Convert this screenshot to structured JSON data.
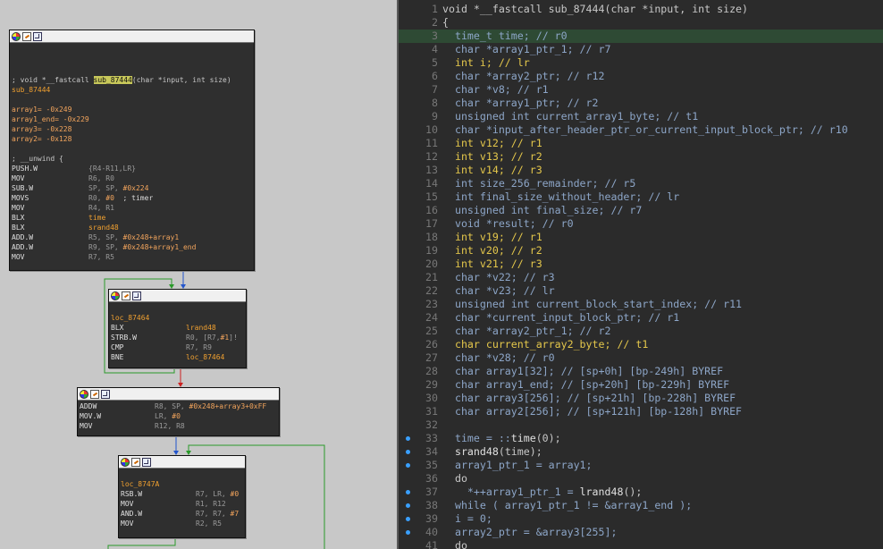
{
  "graph_view": {
    "nodes": [
      {
        "id": "sub_87444",
        "header": [
          {
            "segments": [
              {
                "t": "; void *__fastcall ",
                "c": "plain"
              },
              {
                "t": "sub_87444",
                "c": "hl"
              },
              {
                "t": "(char *input, int size)",
                "c": "plain"
              }
            ]
          },
          {
            "segments": [
              {
                "t": "sub_87444",
                "c": "lbl"
              }
            ]
          },
          {
            "segments": []
          },
          {
            "segments": [
              {
                "t": "array1= ",
                "c": "var"
              },
              {
                "t": "-0x249",
                "c": "var"
              }
            ]
          },
          {
            "segments": [
              {
                "t": "array1_end= ",
                "c": "var"
              },
              {
                "t": "-0x229",
                "c": "var"
              }
            ]
          },
          {
            "segments": [
              {
                "t": "array3= ",
                "c": "var"
              },
              {
                "t": "-0x228",
                "c": "var"
              }
            ]
          },
          {
            "segments": [
              {
                "t": "array2= ",
                "c": "var"
              },
              {
                "t": "-0x128",
                "c": "var"
              }
            ]
          },
          {
            "segments": []
          },
          {
            "segments": [
              {
                "t": "; __unwind {",
                "c": "plain"
              }
            ]
          }
        ],
        "lines": [
          {
            "mn": "PUSH.W",
            "ops": [
              {
                "t": "{R4-R11,LR}",
                "c": "reg"
              }
            ]
          },
          {
            "mn": "MOV",
            "ops": [
              {
                "t": "R6, R0",
                "c": "reg"
              }
            ]
          },
          {
            "mn": "SUB.W",
            "ops": [
              {
                "t": "SP, SP, ",
                "c": "reg"
              },
              {
                "t": "#0x224",
                "c": "num"
              }
            ]
          },
          {
            "mn": "MOVS",
            "ops": [
              {
                "t": "R0, ",
                "c": "reg"
              },
              {
                "t": "#0",
                "c": "num"
              },
              {
                "t": "  ; timer",
                "c": "cmt"
              }
            ]
          },
          {
            "mn": "MOV",
            "ops": [
              {
                "t": "R4, R1",
                "c": "reg"
              }
            ]
          },
          {
            "mn": "BLX",
            "ops": [
              {
                "t": "time",
                "c": "sym"
              }
            ]
          },
          {
            "mn": "BLX",
            "ops": [
              {
                "t": "srand48",
                "c": "sym"
              }
            ]
          },
          {
            "mn": "ADD.W",
            "ops": [
              {
                "t": "R5, SP, ",
                "c": "reg"
              },
              {
                "t": "#0x248+array1",
                "c": "num"
              }
            ]
          },
          {
            "mn": "ADD.W",
            "ops": [
              {
                "t": "R9, SP, ",
                "c": "reg"
              },
              {
                "t": "#0x248+array1_end",
                "c": "num"
              }
            ]
          },
          {
            "mn": "MOV",
            "ops": [
              {
                "t": "R7, R5",
                "c": "reg"
              }
            ]
          }
        ]
      },
      {
        "id": "loc_87464",
        "header": [
          {
            "segments": []
          },
          {
            "segments": [
              {
                "t": "loc_87464",
                "c": "lbl"
              }
            ]
          }
        ],
        "lines": [
          {
            "mn": "BLX",
            "ops": [
              {
                "t": "lrand48",
                "c": "sym"
              }
            ]
          },
          {
            "mn": "STRB.W",
            "ops": [
              {
                "t": "R0, [R7,",
                "c": "reg"
              },
              {
                "t": "#1",
                "c": "num"
              },
              {
                "t": "]!",
                "c": "reg"
              }
            ]
          },
          {
            "mn": "CMP",
            "ops": [
              {
                "t": "R7, R9",
                "c": "reg"
              }
            ]
          },
          {
            "mn": "BNE",
            "ops": [
              {
                "t": "loc_87464",
                "c": "sym"
              }
            ]
          }
        ]
      },
      {
        "id": "block_3",
        "header": [],
        "lines": [
          {
            "mn": "ADDW",
            "ops": [
              {
                "t": "R8, SP, ",
                "c": "reg"
              },
              {
                "t": "#0x248+array3+0xFF",
                "c": "num"
              }
            ]
          },
          {
            "mn": "MOV.W",
            "ops": [
              {
                "t": "LR, ",
                "c": "reg"
              },
              {
                "t": "#0",
                "c": "num"
              }
            ]
          },
          {
            "mn": "MOV",
            "ops": [
              {
                "t": "R12, R8",
                "c": "reg"
              }
            ]
          }
        ]
      },
      {
        "id": "loc_8747A",
        "header": [
          {
            "segments": []
          },
          {
            "segments": [
              {
                "t": "loc_8747A",
                "c": "lbl"
              }
            ]
          }
        ],
        "lines": [
          {
            "mn": "RSB.W",
            "ops": [
              {
                "t": "R7, LR, ",
                "c": "reg"
              },
              {
                "t": "#0",
                "c": "num"
              }
            ]
          },
          {
            "mn": "MOV",
            "ops": [
              {
                "t": "R1, R12",
                "c": "reg"
              }
            ]
          },
          {
            "mn": "AND.W",
            "ops": [
              {
                "t": "R7, R7, ",
                "c": "reg"
              },
              {
                "t": "#7",
                "c": "num"
              }
            ]
          },
          {
            "mn": "MOV",
            "ops": [
              {
                "t": "R2, R5",
                "c": "reg"
              }
            ]
          }
        ]
      }
    ]
  },
  "pseudocode": {
    "current_line": 3,
    "lines": [
      {
        "n": "1",
        "dot": false,
        "segs": [
          {
            "t": "void *__fastcall sub_87444(char *input, int size)",
            "c": "plain"
          }
        ]
      },
      {
        "n": "2",
        "dot": false,
        "segs": [
          {
            "t": "{",
            "c": "plain"
          }
        ]
      },
      {
        "n": "3",
        "dot": false,
        "segs": [
          {
            "t": "  time_t ",
            "c": "ty"
          },
          {
            "t": "time",
            "c": "ident"
          },
          {
            "t": "; // r0",
            "c": "ty"
          }
        ]
      },
      {
        "n": "4",
        "dot": false,
        "segs": [
          {
            "t": "  char *array1_ptr_1; // r7",
            "c": "ty"
          }
        ]
      },
      {
        "n": "5",
        "dot": false,
        "segs": [
          {
            "t": "  int i; // lr",
            "c": "kw"
          }
        ]
      },
      {
        "n": "6",
        "dot": false,
        "segs": [
          {
            "t": "  char *array2_ptr; // r12",
            "c": "ty"
          }
        ]
      },
      {
        "n": "7",
        "dot": false,
        "segs": [
          {
            "t": "  char *v8; // r1",
            "c": "ty"
          }
        ]
      },
      {
        "n": "8",
        "dot": false,
        "segs": [
          {
            "t": "  char *array1_ptr; // r2",
            "c": "ty"
          }
        ]
      },
      {
        "n": "9",
        "dot": false,
        "segs": [
          {
            "t": "  unsigned int current_array1_byte; // t1",
            "c": "ty"
          }
        ]
      },
      {
        "n": "10",
        "dot": false,
        "segs": [
          {
            "t": "  char *input_after_header_ptr_or_current_input_block_ptr; // r10",
            "c": "ty"
          }
        ]
      },
      {
        "n": "11",
        "dot": false,
        "segs": [
          {
            "t": "  int v12; // r1",
            "c": "kw"
          }
        ]
      },
      {
        "n": "12",
        "dot": false,
        "segs": [
          {
            "t": "  int v13; // r2",
            "c": "kw"
          }
        ]
      },
      {
        "n": "13",
        "dot": false,
        "segs": [
          {
            "t": "  int v14; // r3",
            "c": "kw"
          }
        ]
      },
      {
        "n": "14",
        "dot": false,
        "segs": [
          {
            "t": "  int size_256_remainder; // r5",
            "c": "ty"
          }
        ]
      },
      {
        "n": "15",
        "dot": false,
        "segs": [
          {
            "t": "  int final_size_without_header; // lr",
            "c": "ty"
          }
        ]
      },
      {
        "n": "16",
        "dot": false,
        "segs": [
          {
            "t": "  unsigned int final_size; // r7",
            "c": "ty"
          }
        ]
      },
      {
        "n": "17",
        "dot": false,
        "segs": [
          {
            "t": "  void *result; // r0",
            "c": "ty"
          }
        ]
      },
      {
        "n": "18",
        "dot": false,
        "segs": [
          {
            "t": "  int v19; // r1",
            "c": "kw"
          }
        ]
      },
      {
        "n": "19",
        "dot": false,
        "segs": [
          {
            "t": "  int v20; // r2",
            "c": "kw"
          }
        ]
      },
      {
        "n": "20",
        "dot": false,
        "segs": [
          {
            "t": "  int v21; // r3",
            "c": "kw"
          }
        ]
      },
      {
        "n": "21",
        "dot": false,
        "segs": [
          {
            "t": "  char *v22; // r3",
            "c": "ty"
          }
        ]
      },
      {
        "n": "22",
        "dot": false,
        "segs": [
          {
            "t": "  char *v23; // lr",
            "c": "ty"
          }
        ]
      },
      {
        "n": "23",
        "dot": false,
        "segs": [
          {
            "t": "  unsigned int current_block_start_index; // r11",
            "c": "ty"
          }
        ]
      },
      {
        "n": "24",
        "dot": false,
        "segs": [
          {
            "t": "  char *current_input_block_ptr; // r1",
            "c": "ty"
          }
        ]
      },
      {
        "n": "25",
        "dot": false,
        "segs": [
          {
            "t": "  char *array2_ptr_1; // r2",
            "c": "ty"
          }
        ]
      },
      {
        "n": "26",
        "dot": false,
        "segs": [
          {
            "t": "  char current_array2_byte; // t1",
            "c": "kw"
          }
        ]
      },
      {
        "n": "27",
        "dot": false,
        "segs": [
          {
            "t": "  char *v28; // r0",
            "c": "ty"
          }
        ]
      },
      {
        "n": "28",
        "dot": false,
        "segs": [
          {
            "t": "  char array1[32]; // [sp+0h] [bp-249h] BYREF",
            "c": "ty"
          }
        ]
      },
      {
        "n": "29",
        "dot": false,
        "segs": [
          {
            "t": "  char array1_end; // [sp+20h] [bp-229h] BYREF",
            "c": "ty"
          }
        ]
      },
      {
        "n": "30",
        "dot": false,
        "segs": [
          {
            "t": "  char array3[256]; // [sp+21h] [bp-228h] BYREF",
            "c": "ty"
          }
        ]
      },
      {
        "n": "31",
        "dot": false,
        "segs": [
          {
            "t": "  char array2[256]; // [sp+121h] [bp-128h] BYREF",
            "c": "ty"
          }
        ]
      },
      {
        "n": "32",
        "dot": false,
        "segs": [
          {
            "t": "",
            "c": "plain"
          }
        ]
      },
      {
        "n": "33",
        "dot": true,
        "segs": [
          {
            "t": "  time = ::",
            "c": "ty"
          },
          {
            "t": "time",
            "c": "fn"
          },
          {
            "t": "(0);",
            "c": "plain"
          }
        ]
      },
      {
        "n": "34",
        "dot": true,
        "segs": [
          {
            "t": "  ",
            "c": "plain"
          },
          {
            "t": "srand48",
            "c": "fn"
          },
          {
            "t": "(time);",
            "c": "plain"
          }
        ]
      },
      {
        "n": "35",
        "dot": true,
        "segs": [
          {
            "t": "  array1_ptr_1 = array1;",
            "c": "ty"
          }
        ]
      },
      {
        "n": "36",
        "dot": false,
        "segs": [
          {
            "t": "  do",
            "c": "plain"
          }
        ]
      },
      {
        "n": "37",
        "dot": true,
        "segs": [
          {
            "t": "    *++array1_ptr_1 = ",
            "c": "ty"
          },
          {
            "t": "lrand48",
            "c": "fn"
          },
          {
            "t": "();",
            "c": "plain"
          }
        ]
      },
      {
        "n": "38",
        "dot": true,
        "segs": [
          {
            "t": "  while ( array1_ptr_1 != &array1_end );",
            "c": "ty"
          }
        ]
      },
      {
        "n": "39",
        "dot": true,
        "segs": [
          {
            "t": "  i = 0;",
            "c": "ty"
          }
        ]
      },
      {
        "n": "40",
        "dot": true,
        "segs": [
          {
            "t": "  array2_ptr = &array3[255];",
            "c": "ty"
          }
        ]
      },
      {
        "n": "41",
        "dot": false,
        "segs": [
          {
            "t": "  do",
            "c": "plain"
          }
        ]
      }
    ]
  },
  "colors": {
    "graph_bg": "#c8c8c8",
    "node_bg": "#2f2f2f",
    "pseudo_bg": "#2b2b2b",
    "current_line": "#2e4a34",
    "edge_true": "#2a9a2a",
    "edge_false": "#cc2222",
    "edge_normal": "#2255cc",
    "breakpoint_dot": "#3aa0ff"
  }
}
